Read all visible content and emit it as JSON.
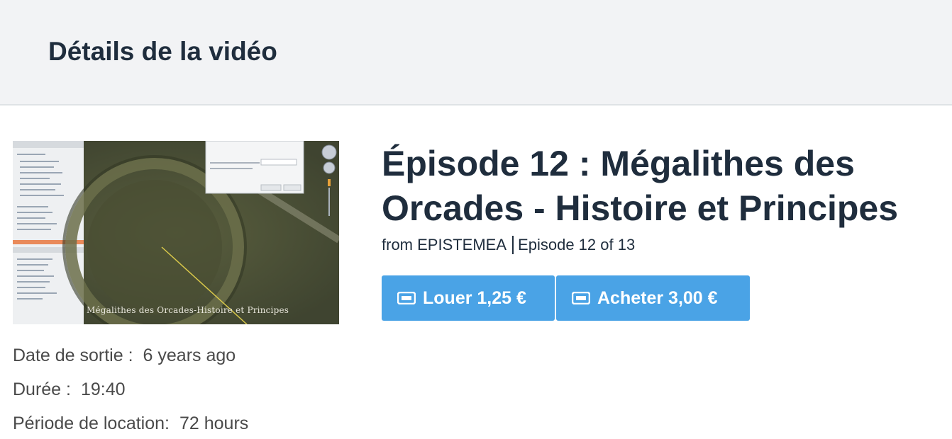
{
  "header": {
    "title": "Détails de la vidéo"
  },
  "video": {
    "thumbnail_caption": "Mégalithes des Orcades-Histoire et Principes",
    "title": "Épisode 12 : Mégalithes des Orcades - Histoire et Principes",
    "from": "from EPISTEMEA",
    "episode": "Episode 12 of 13"
  },
  "actions": {
    "rent_label": "Louer 1,25 €",
    "buy_label": "Acheter 3,00 €",
    "icon": "ticket-icon",
    "button_color": "#4aa3e6"
  },
  "meta": {
    "release_label": "Date de sortie :",
    "release_value": "6 years ago",
    "duration_label": "Durée :",
    "duration_value": "19:40",
    "rental_label": "Période de location:",
    "rental_value": "72 hours"
  }
}
